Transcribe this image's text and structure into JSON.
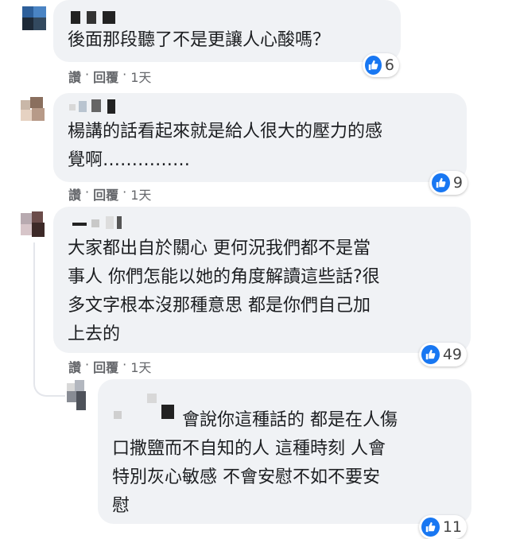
{
  "comments": [
    {
      "text": "後面那段聽了不是更讓人心酸嗎？",
      "reaction_count": "6",
      "actions": {
        "like": "讚",
        "sep": "·",
        "reply": "回覆",
        "time": "1天"
      }
    },
    {
      "text": "楊講的話看起來就是給人很大的壓力的感\n覺啊……………",
      "reaction_count": "9",
      "actions": {
        "like": "讚",
        "sep": "·",
        "reply": "回覆",
        "time": "1天"
      }
    },
    {
      "text": "大家都出自於關心 更何況我們都不是當\n事人 你們怎能以她的角度解讀這些話?很\n多文字根本沒那種意思 都是你們自己加\n上去的",
      "reaction_count": "49",
      "actions": {
        "like": "讚",
        "sep": "·",
        "reply": "回覆",
        "time": "1天"
      }
    }
  ],
  "reply": {
    "first_line": "會說你這種話的 都是在人傷",
    "text": "口撒鹽而不自知的人 這種時刻 人會\n特別灰心敏感 不會安慰不如不要安\n慰",
    "reaction_count": "11"
  },
  "colors": {
    "bubble": "#f0f2f5",
    "like": "#1877f2",
    "meta": "#65676b"
  },
  "icons": {
    "reaction": "thumbs-up-icon"
  }
}
